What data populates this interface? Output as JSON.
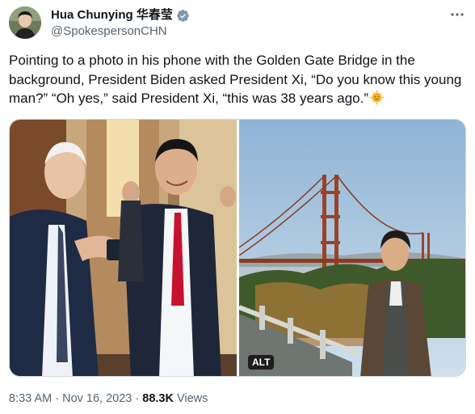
{
  "author": {
    "display_name": "Hua Chunying 华春莹",
    "handle": "@SpokespersonCHN",
    "verified": true
  },
  "tweet": {
    "text": "Pointing to a photo in his phone with the Golden Gate Bridge in the background, President Biden asked President Xi, “Do you know this young man?” “Oh yes,” said President Xi, “this was 38 years ago.”",
    "emoji": "sun-with-face"
  },
  "media": {
    "alt_badge": "ALT"
  },
  "meta": {
    "time": "8:33 AM",
    "separator": " · ",
    "date": "Nov 16, 2023",
    "views_count": "88.3K",
    "views_label": " Views"
  },
  "icons": {
    "verified": "verified-badge-icon",
    "more": "more-options-icon"
  },
  "colors": {
    "verified_badge": "#829aab",
    "secondary_text": "#536471",
    "primary_text": "#0f1419"
  }
}
